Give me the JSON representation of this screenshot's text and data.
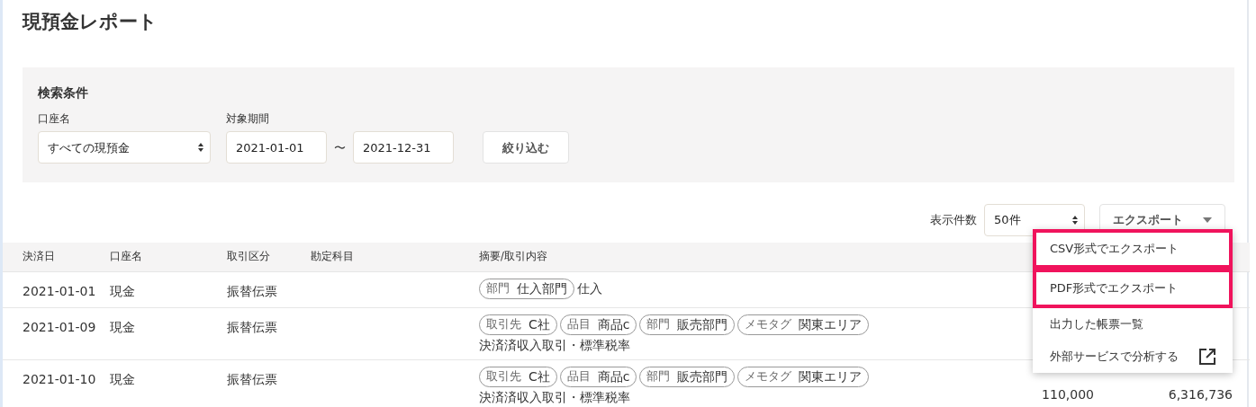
{
  "page_title": "現預金レポート",
  "search": {
    "title": "検索条件",
    "account": {
      "label": "口座名",
      "value": "すべての現預金"
    },
    "period": {
      "label": "対象期間",
      "from": "2021-01-01",
      "separator": "〜",
      "to": "2021-12-31"
    },
    "filter_button": "絞り込む"
  },
  "toolbar": {
    "per_page_label": "表示件数",
    "per_page": "50件",
    "export_button": "エクスポート"
  },
  "export_menu": [
    {
      "label": "CSV形式でエクスポート",
      "kind": "action",
      "highlighted": true
    },
    {
      "label": "PDF形式でエクスポート",
      "kind": "action",
      "highlighted": true
    },
    {
      "label": "出力した帳票一覧",
      "kind": "action",
      "highlighted": false
    },
    {
      "label": "外部サービスで分析する",
      "kind": "external",
      "highlighted": false
    }
  ],
  "table": {
    "columns": [
      "決済日",
      "口座名",
      "取引区分",
      "勘定科目",
      "摘要/取引内容"
    ],
    "rows": [
      {
        "date": "2021-01-01",
        "account": "現金",
        "type": "振替伝票",
        "tags": [
          {
            "label": "部門",
            "value": "仕入部門"
          }
        ],
        "description": "仕入"
      },
      {
        "date": "2021-01-09",
        "account": "現金",
        "type": "振替伝票",
        "tags": [
          {
            "label": "取引先",
            "value": "C社"
          },
          {
            "label": "品目",
            "value": "商品c"
          },
          {
            "label": "部門",
            "value": "販売部門"
          },
          {
            "label": "メモタグ",
            "value": "関東エリア"
          }
        ],
        "description": "決済済収入取引・標準税率"
      },
      {
        "date": "2021-01-10",
        "account": "現金",
        "type": "振替伝票",
        "tags": [
          {
            "label": "取引先",
            "value": "C社"
          },
          {
            "label": "品目",
            "value": "商品c"
          },
          {
            "label": "部門",
            "value": "販売部門"
          },
          {
            "label": "メモタグ",
            "value": "関東エリア"
          }
        ],
        "description": "決済済収入取引・標準税率",
        "column_6": "110,000",
        "column_7": "6,316,736"
      }
    ]
  }
}
